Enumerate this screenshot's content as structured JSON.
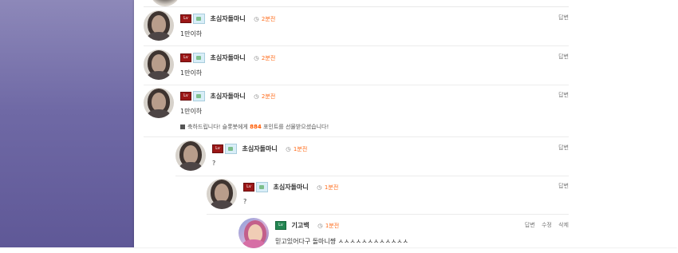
{
  "comments": [
    {
      "name": "초심자돌마니",
      "time": "2분전",
      "text": "1만이하",
      "action": "답변"
    },
    {
      "name": "초심자돌마니",
      "time": "2분전",
      "text": "1만이하",
      "action": "답변"
    },
    {
      "name": "초심자돌마니",
      "time": "2분전",
      "text": "1만이하",
      "action": "답변",
      "notice_before": "축하드립니다! 슬롯봇에게",
      "points": "884",
      "notice_after": "포인트를 선물받으셨습니다!"
    },
    {
      "name": "초심자돌마니",
      "time": "1분전",
      "text": "?",
      "action": "답변"
    },
    {
      "name": "초심자돌마니",
      "time": "1분전",
      "text": "?",
      "action": "답변"
    },
    {
      "name": "기고백",
      "time": "1분전",
      "text": "믿고있어다구 돌마니쨩 ㅅㅅㅅㅅㅅㅅㅅㅅㅅㅅㅅㅅ",
      "actions": [
        "답변",
        "수정",
        "삭제"
      ]
    }
  ],
  "icons": {
    "clock": "clock-icon",
    "gift": "gift-icon",
    "level": "level-badge-icon",
    "profile": "mini-profile-icon"
  },
  "colors": {
    "time": "#ff6b1a",
    "points": "#ff5a00",
    "level_red": "#9b1717",
    "level_green": "#238552"
  }
}
